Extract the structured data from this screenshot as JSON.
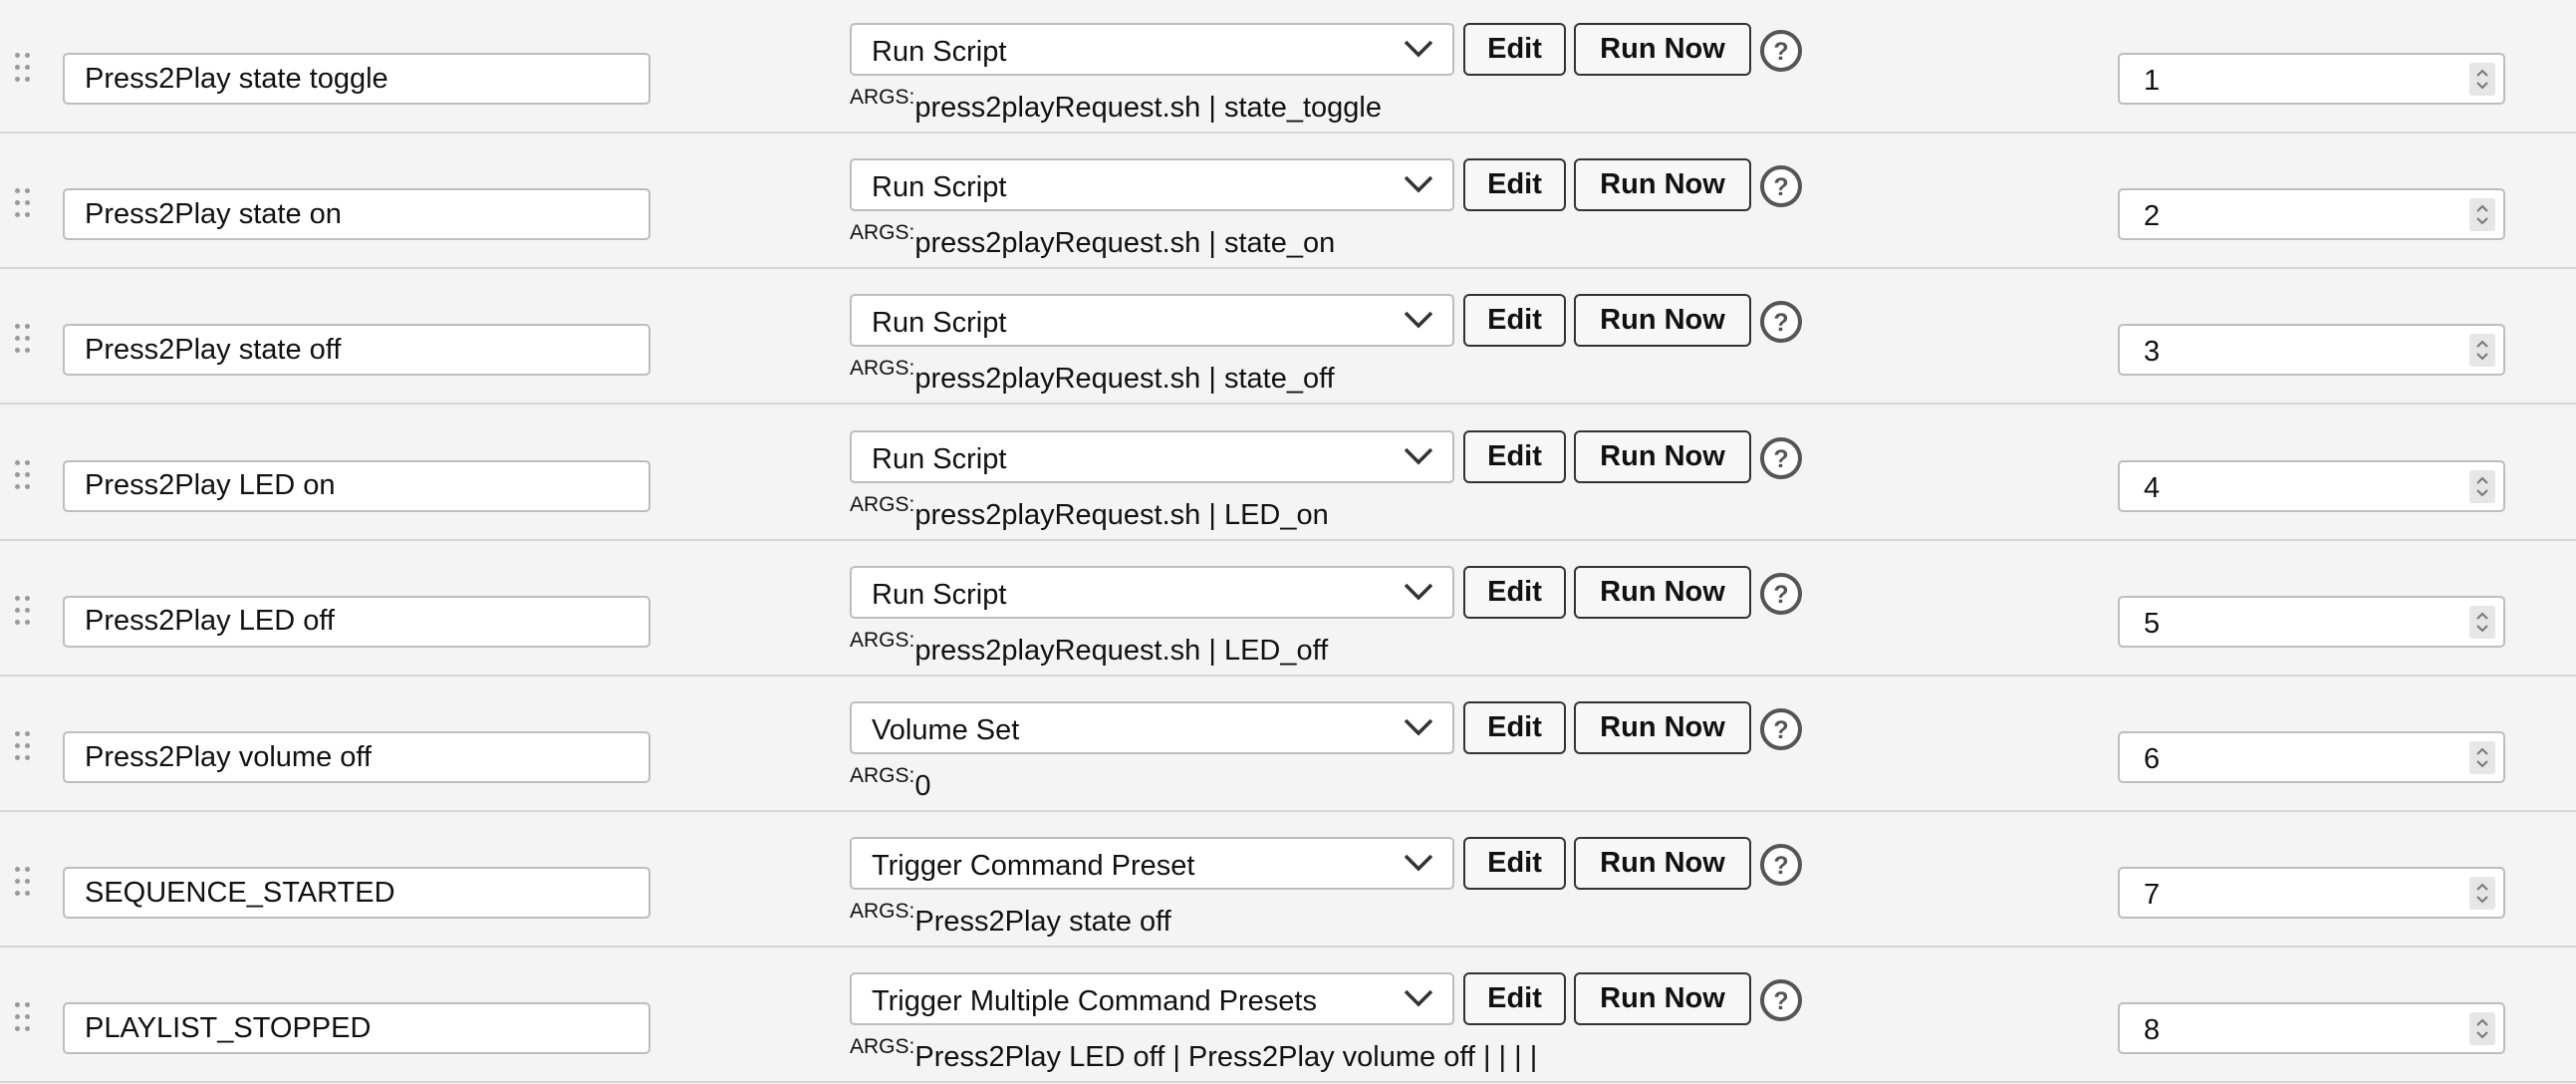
{
  "args_label": "ARGS:",
  "buttons": {
    "edit": "Edit",
    "run_now": "Run Now"
  },
  "presets": [
    {
      "name": "Press2Play state toggle",
      "command": "Run Script",
      "args": "press2playRequest.sh | state_toggle",
      "order": "1"
    },
    {
      "name": "Press2Play state on",
      "command": "Run Script",
      "args": "press2playRequest.sh | state_on",
      "order": "2"
    },
    {
      "name": "Press2Play state off",
      "command": "Run Script",
      "args": "press2playRequest.sh | state_off",
      "order": "3"
    },
    {
      "name": "Press2Play LED on",
      "command": "Run Script",
      "args": "press2playRequest.sh | LED_on",
      "order": "4"
    },
    {
      "name": "Press2Play LED off",
      "command": "Run Script",
      "args": "press2playRequest.sh | LED_off",
      "order": "5"
    },
    {
      "name": "Press2Play volume off",
      "command": "Volume Set",
      "args": "0",
      "order": "6"
    },
    {
      "name": "SEQUENCE_STARTED",
      "command": "Trigger Command Preset",
      "args": "Press2Play state off",
      "order": "7"
    },
    {
      "name": "PLAYLIST_STOPPED",
      "command": "Trigger Multiple Command Presets",
      "args": "Press2Play LED off | Press2Play volume off | | | |",
      "order": "8"
    }
  ],
  "icons": {
    "drag": "drag-handle-icon",
    "dropdown": "chevron-down-icon",
    "help": "help-question-icon",
    "spinner": "number-spinner-icon"
  }
}
